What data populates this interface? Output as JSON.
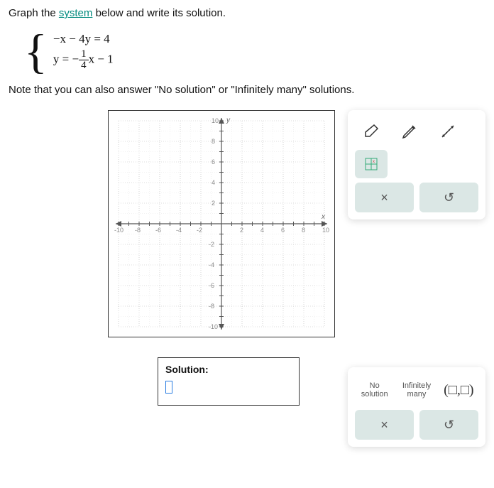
{
  "prompt": {
    "pre": "Graph the ",
    "link": "system",
    "post": " below and write its solution."
  },
  "equations": {
    "eq1": "−x − 4y = 4",
    "eq2_lhs": "y = −",
    "eq2_frac_num": "1",
    "eq2_frac_den": "4",
    "eq2_rhs": "x − 1"
  },
  "note": "Note that you can also answer \"No solution\" or \"Infinitely many\" solutions.",
  "graph": {
    "x_label": "x",
    "y_label": "y",
    "ticks_pos": [
      "2",
      "4",
      "6",
      "8",
      "10"
    ],
    "ticks_neg": [
      "-2",
      "-4",
      "-6",
      "-8",
      "-10"
    ]
  },
  "solution": {
    "label": "Solution:"
  },
  "tools": {
    "eraser": "eraser-icon",
    "pencil": "pencil-icon",
    "line": "line-icon",
    "grid": "grid-icon",
    "clear": "×",
    "reset": "↺"
  },
  "answer_options": {
    "no_solution_l1": "No",
    "no_solution_l2": "solution",
    "inf_l1": "Infinitely",
    "inf_l2": "many",
    "pair": "(□,□)",
    "clear": "×",
    "reset": "↺"
  }
}
